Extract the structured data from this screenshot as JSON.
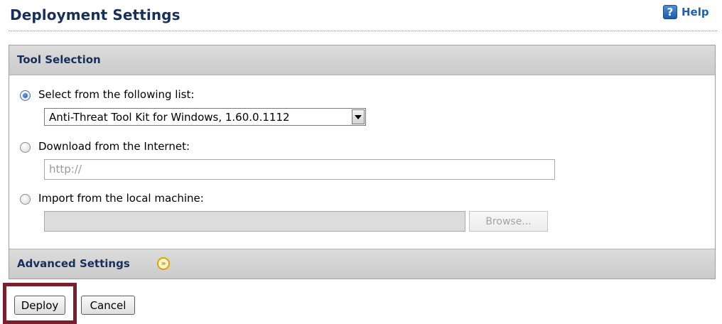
{
  "page": {
    "title": "Deployment Settings",
    "help_label": "Help",
    "help_icon": "?"
  },
  "tool_selection": {
    "header": "Tool Selection",
    "options": [
      {
        "label": "Select from the following list:",
        "checked": true
      },
      {
        "label": "Download from the Internet:",
        "checked": false
      },
      {
        "label": "Import from the local machine:",
        "checked": false
      }
    ],
    "tool_list_selected": "Anti-Threat Tool Kit for Windows, 1.60.0.1112",
    "url_placeholder": "http://",
    "browse_label": "Browse..."
  },
  "advanced": {
    "label": "Advanced Settings",
    "expand_icon": "expand-chevrons-icon"
  },
  "actions": {
    "deploy_label": "Deploy",
    "cancel_label": "Cancel"
  },
  "colors": {
    "title": "#17305a",
    "highlight_border": "#7b1f2c",
    "panel_header": "#d2d2d2"
  }
}
